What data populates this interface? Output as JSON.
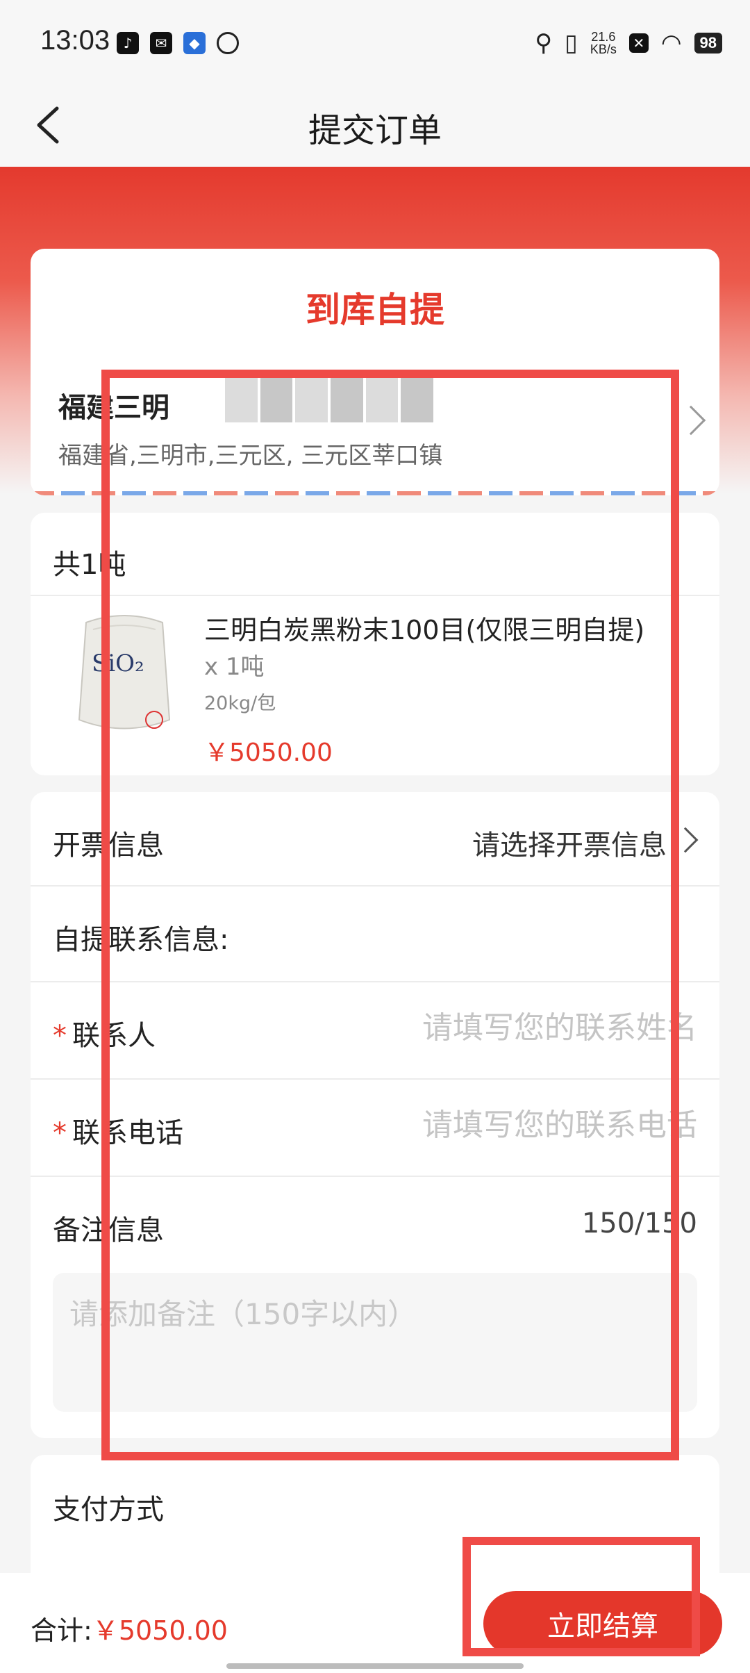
{
  "status_bar": {
    "time": "13:03",
    "net_speed_value": "21.6",
    "net_speed_unit": "KB/s",
    "battery": "98"
  },
  "header": {
    "title": "提交订单"
  },
  "address": {
    "mode_title": "到库自提",
    "name": "福建三明",
    "detail": "福建省,三明市,三元区, 三元区莘口镇"
  },
  "product": {
    "count_label": "共1吨",
    "name": "三明白炭黑粉末100目(仅限三明自提)",
    "quantity": "x 1吨",
    "spec": "20kg/包",
    "price": "￥5050.00",
    "image_label": "SiO₂"
  },
  "form": {
    "invoice_label": "开票信息",
    "invoice_value": "请选择开票信息",
    "contact_section_label": "自提联系信息:",
    "contact_person_label": "联系人",
    "contact_person_placeholder": "请填写您的联系姓名",
    "contact_phone_label": "联系电话",
    "contact_phone_placeholder": "请填写您的联系电话",
    "required_mark": "*",
    "remark_label": "备注信息",
    "remark_counter": "150/150",
    "remark_placeholder": "请添加备注（150字以内）"
  },
  "payment": {
    "label": "支付方式"
  },
  "bottom_bar": {
    "total_label": "合计:",
    "total_amount": "￥5050.00",
    "checkout_label": "立即结算"
  },
  "colors": {
    "brand_red": "#e53a2c",
    "annotation_red": "#ef4b47"
  }
}
